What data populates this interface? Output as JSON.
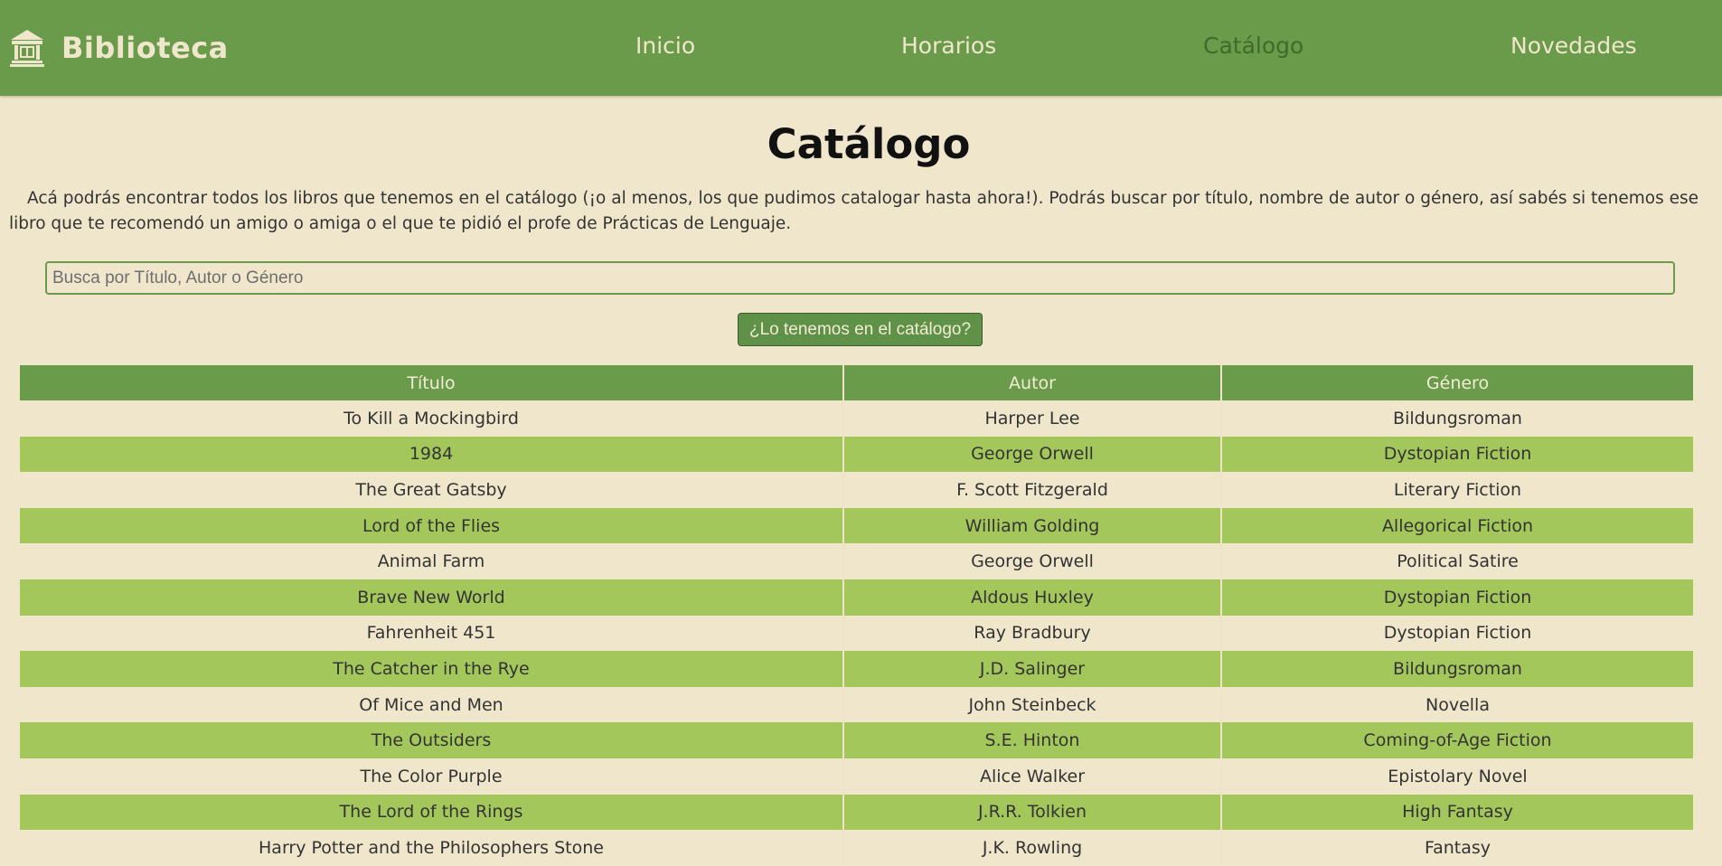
{
  "header": {
    "brand": "Biblioteca",
    "logo_icon": "library-building-icon",
    "nav": [
      {
        "label": "Inicio",
        "active": false
      },
      {
        "label": "Horarios",
        "active": false
      },
      {
        "label": "Catálogo",
        "active": true
      },
      {
        "label": "Novedades",
        "active": false
      }
    ]
  },
  "main": {
    "title": "Catálogo",
    "intro": "Acá podrás encontrar todos los libros que tenemos en el catálogo (¡o al menos, los que pudimos catalogar hasta ahora!). Podrás buscar por título, nombre de autor o género, así sabés si tenemos ese libro que te recomendó un amigo o amiga o el que te pidió el profe de Prácticas de Lenguaje.",
    "search": {
      "placeholder": "Busca por Título, Autor o Género",
      "value": "",
      "button_label": "¿Lo tenemos en el catálogo?"
    }
  },
  "table": {
    "headers": [
      "Título",
      "Autor",
      "Género"
    ],
    "rows": [
      [
        "To Kill a Mockingbird",
        "Harper Lee",
        "Bildungsroman"
      ],
      [
        "1984",
        "George Orwell",
        "Dystopian Fiction"
      ],
      [
        "The Great Gatsby",
        "F. Scott Fitzgerald",
        "Literary Fiction"
      ],
      [
        "Lord of the Flies",
        "William Golding",
        "Allegorical Fiction"
      ],
      [
        "Animal Farm",
        "George Orwell",
        "Political Satire"
      ],
      [
        "Brave New World",
        "Aldous Huxley",
        "Dystopian Fiction"
      ],
      [
        "Fahrenheit 451",
        "Ray Bradbury",
        "Dystopian Fiction"
      ],
      [
        "The Catcher in the Rye",
        "J.D. Salinger",
        "Bildungsroman"
      ],
      [
        "Of Mice and Men",
        "John Steinbeck",
        "Novella"
      ],
      [
        "The Outsiders",
        "S.E. Hinton",
        "Coming-of-Age Fiction"
      ],
      [
        "The Color Purple",
        "Alice Walker",
        "Epistolary Novel"
      ],
      [
        "The Lord of the Rings",
        "J.R.R. Tolkien",
        "High Fantasy"
      ],
      [
        "Harry Potter and the Philosophers Stone",
        "J.K. Rowling",
        "Fantasy"
      ]
    ]
  },
  "colors": {
    "header_bg": "#6a9b4b",
    "page_bg": "#f0e6cc",
    "row_alt": "#a4c75c",
    "active_nav": "#3f6b2a"
  }
}
